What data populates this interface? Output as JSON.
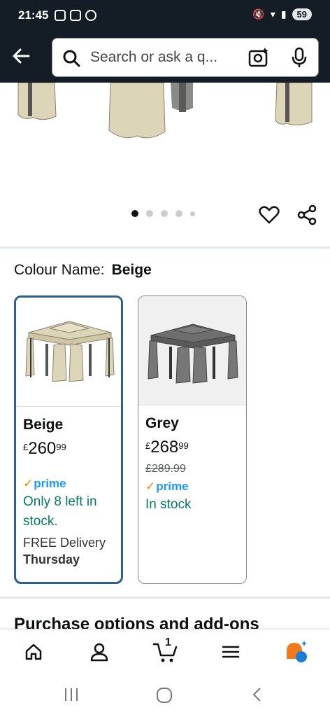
{
  "status_bar": {
    "time": "21:45",
    "battery": "59"
  },
  "search": {
    "placeholder": "Search or ask a q..."
  },
  "gallery": {
    "dot_count": 5,
    "active_index": 0
  },
  "colour": {
    "label": "Colour Name:",
    "selected": "Beige"
  },
  "swatches": [
    {
      "name": "Beige",
      "currency": "£",
      "price_whole": "260",
      "price_fraction": "99",
      "prime": "prime",
      "stock": "Only 8 left in stock.",
      "delivery": "FREE Delivery",
      "delivery_day": "Thursday"
    },
    {
      "name": "Grey",
      "currency": "£",
      "price_whole": "268",
      "price_fraction": "99",
      "was_price": "£289.99",
      "prime": "prime",
      "stock": "In stock"
    }
  ],
  "section": {
    "purchase_title": "Purchase options and add-ons"
  },
  "bottom_nav": {
    "cart_count": "1"
  },
  "colors": {
    "header_bg": "#141d26",
    "selected_border": "#2d5f8f",
    "stock_green": "#067d62",
    "prime_blue": "#1a98ff",
    "prime_check": "#f08804"
  }
}
